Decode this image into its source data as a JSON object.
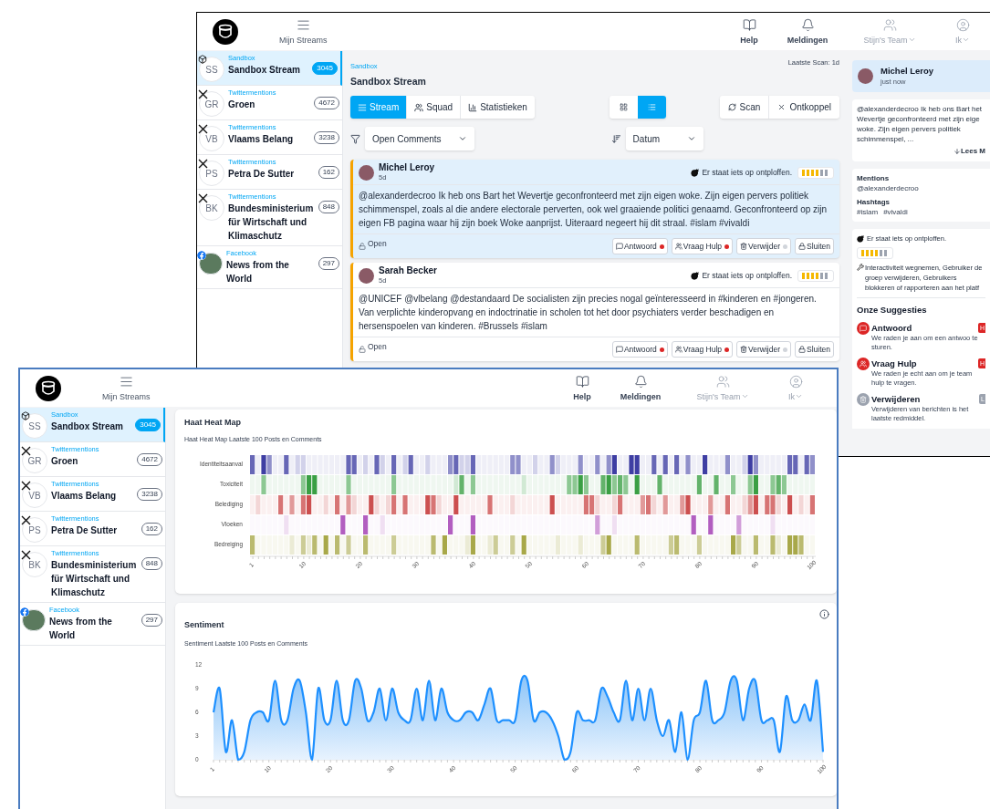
{
  "back_window": {
    "header": {
      "nav_label": "Mijn Streams",
      "items": [
        {
          "kind": "help",
          "label": "Help",
          "dropdown": false
        },
        {
          "kind": "bell",
          "label": "Meldingen",
          "dropdown": false
        },
        {
          "kind": "team",
          "label": "Stijn's Team",
          "dropdown": true
        },
        {
          "kind": "user",
          "label": "Ik",
          "dropdown": true
        }
      ]
    },
    "sidebar": [
      {
        "kind": "sandbox",
        "source": "Sandbox",
        "name": "Sandbox Stream",
        "initials": "SS",
        "count": "3045",
        "selected": true
      },
      {
        "kind": "x",
        "source": "Twittermentions",
        "name": "Groen",
        "initials": "GR",
        "count": "4672",
        "selected": false
      },
      {
        "kind": "x",
        "source": "Twittermentions",
        "name": "Vlaams Belang",
        "initials": "VB",
        "count": "3238",
        "selected": false
      },
      {
        "kind": "x",
        "source": "Twittermentions",
        "name": "Petra De Sutter",
        "initials": "PS",
        "count": "162",
        "selected": false
      },
      {
        "kind": "x",
        "source": "Twittermentions",
        "name": "Bundesministerium für Wirtschaft und Klimaschutz",
        "initials": "BK",
        "count": "848",
        "selected": false
      },
      {
        "kind": "facebook",
        "source": "Facebook",
        "name": "News from the World",
        "count": "297",
        "selected": false
      }
    ],
    "stream": {
      "category": "Sandbox",
      "title": "Sandbox Stream",
      "last_scan": "Laatste Scan: 1d",
      "tabs": [
        {
          "kind": "stream",
          "label": "Stream",
          "selected": true
        },
        {
          "kind": "squad",
          "label": "Squad",
          "selected": false
        },
        {
          "kind": "stats",
          "label": "Statistieken",
          "selected": false
        }
      ],
      "views": [
        {
          "kind": "grid",
          "selected": false
        },
        {
          "kind": "list",
          "selected": true
        }
      ],
      "actions": [
        {
          "kind": "scan",
          "label": "Scan"
        },
        {
          "kind": "disconnect",
          "label": "Ontkoppel"
        }
      ],
      "filter": {
        "value": "Open Comments"
      },
      "sort": {
        "value": "Datum"
      },
      "posts": [
        {
          "author": "Michel Leroy",
          "age": "5d",
          "selected": true,
          "alert": "Er staat iets op ontploffen.",
          "level": 0.67,
          "text": "@alexanderdecroo Ik heb ons Bart het Wevertje geconfronteerd met zijn eigen woke. Zijn eigen pervers politiek schimmenspel, zoals al die andere electorale perverten, ook wel graaiende politici genaamd. Geconfronteerd op zijn eigen FB pagina waar hij zijn boek Woke aanprijst. Uiteraard negeert hij dit straal. #islam #vivaldi",
          "status": "Open",
          "actions": [
            {
              "kind": "reply",
              "label": "Antwoord",
              "color": "#dc2626"
            },
            {
              "kind": "help",
              "label": "Vraag Hulp",
              "color": "#dc2626"
            },
            {
              "kind": "delete",
              "label": "Verwijder",
              "color": "#d1d5db"
            },
            {
              "kind": "close",
              "label": "Sluiten"
            }
          ]
        },
        {
          "author": "Sarah Becker",
          "age": "5d",
          "selected": false,
          "alert": "Er staat iets op ontploffen.",
          "level": 0.67,
          "text": "@UNICEF @vlbelang @destandaard De socialisten zijn precies nogal geïnteresseerd in #kinderen en #jongeren. Van verplichte kinderopvang en indoctrinatie in scholen tot het door psychiaters verder beschadigen en hersenspoelen van kinderen. #Brussels #islam",
          "status": "Open",
          "actions": [
            {
              "kind": "reply",
              "label": "Antwoord",
              "color": "#dc2626"
            },
            {
              "kind": "help",
              "label": "Vraag Hulp",
              "color": "#dc2626"
            },
            {
              "kind": "delete",
              "label": "Verwijder",
              "color": "#d1d5db"
            },
            {
              "kind": "close",
              "label": "Sluiten"
            }
          ]
        }
      ]
    },
    "detail": {
      "author": "Michel Leroy",
      "time": "just now",
      "excerpt": "@alexanderdecroo Ik heb ons Bart het Wevertje geconfronteerd met zijn eige woke. Zijn eigen pervers politiek schimmenspel, ...",
      "more": "Lees M",
      "mentions": {
        "label": "Mentions",
        "values": [
          "@alexanderdecroo"
        ]
      },
      "hashtags": {
        "label": "Hashtags",
        "values": [
          "#islam",
          "#vivaldi"
        ]
      },
      "alert": {
        "text": "Er staat iets op ontploffen.",
        "level": 0.67,
        "advice": "Interactiviteit wegnemen, Gebruiker de groep verwijderen, Gebruikers blokkeren of rapporteren aan het platf"
      },
      "suggestions": {
        "title": "Onze Suggesties",
        "items": [
          {
            "kind": "reply",
            "title": "Antwoord",
            "badge": "H",
            "color": "#dc2626",
            "text": "We raden je aan om een antwoo te sturen."
          },
          {
            "kind": "help",
            "title": "Vraag Hulp",
            "badge": "H",
            "color": "#dc2626",
            "text": "We raden je echt aan om je team hulp te vragen."
          },
          {
            "kind": "delete",
            "title": "Verwijderen",
            "badge": "L",
            "color": "#9ca3af",
            "text": "Verwijderen van berichten is het laatste redmiddel."
          }
        ]
      }
    }
  },
  "front_window": {
    "header": {
      "nav_label": "Mijn Streams",
      "items": [
        {
          "kind": "help",
          "label": "Help",
          "dropdown": false
        },
        {
          "kind": "bell",
          "label": "Meldingen",
          "dropdown": false
        },
        {
          "kind": "team",
          "label": "Stijn's Team",
          "dropdown": true
        },
        {
          "kind": "user",
          "label": "Ik",
          "dropdown": true
        }
      ]
    },
    "sidebar": [
      {
        "kind": "sandbox",
        "source": "Sandbox",
        "name": "Sandbox Stream",
        "initials": "SS",
        "count": "3045",
        "selected": true
      },
      {
        "kind": "x",
        "source": "Twittermentions",
        "name": "Groen",
        "initials": "GR",
        "count": "4672",
        "selected": false
      },
      {
        "kind": "x",
        "source": "Twittermentions",
        "name": "Vlaams Belang",
        "initials": "VB",
        "count": "3238",
        "selected": false
      },
      {
        "kind": "x",
        "source": "Twittermentions",
        "name": "Petra De Sutter",
        "initials": "PS",
        "count": "162",
        "selected": false
      },
      {
        "kind": "x",
        "source": "Twittermentions",
        "name": "Bundesministerium für Wirtschaft und Klimaschutz",
        "initials": "BK",
        "count": "848",
        "selected": false
      },
      {
        "kind": "facebook",
        "source": "Facebook",
        "name": "News from the World",
        "count": "297",
        "selected": false
      }
    ],
    "heatmap": {
      "title": "Haat Heat Map",
      "subtitle": "Haat Heat Map Laatste 100 Posts en Comments",
      "rows": [
        {
          "label": "Identiteitsaanval",
          "color": "#34349e"
        },
        {
          "label": "Toxiciteit",
          "color": "#2f9a3a"
        },
        {
          "label": "Belediging",
          "color": "#c94646"
        },
        {
          "label": "Vloeken",
          "color": "#b25ec0"
        },
        {
          "label": "Bedreiging",
          "color": "#a3a33f"
        }
      ],
      "xticks": [
        "1",
        "10",
        "20",
        "30",
        "40",
        "50",
        "60",
        "70",
        "80",
        "90",
        "100"
      ]
    },
    "sentiment": {
      "subtitle": "Sentiment Laatste 100 Posts en Comments",
      "chart_data": {
        "type": "area",
        "title": "Sentiment",
        "x": [
          1,
          2,
          3,
          4,
          5,
          6,
          7,
          8,
          9,
          10,
          11,
          12,
          13,
          14,
          15,
          16,
          17,
          18,
          19,
          20,
          21,
          22,
          23,
          24,
          25,
          26,
          27,
          28,
          29,
          30,
          31,
          32,
          33,
          34,
          35,
          36,
          37,
          38,
          39,
          40,
          41,
          42,
          43,
          44,
          45,
          46,
          47,
          48,
          49,
          50,
          51,
          52,
          53,
          54,
          55,
          56,
          57,
          58,
          59,
          60,
          61,
          62,
          63,
          64,
          65,
          66,
          67,
          68,
          69,
          70,
          71,
          72,
          73,
          74,
          75,
          76,
          77,
          78,
          79,
          80,
          81,
          82,
          83,
          84,
          85,
          86,
          87,
          88,
          89,
          90,
          91,
          92,
          93,
          94,
          95,
          96,
          97,
          98,
          99,
          100
        ],
        "xlim": [
          1,
          100
        ],
        "ylim": [
          0,
          12
        ],
        "xticks": [
          {
            "value": 1,
            "label": "1"
          },
          {
            "value": 10,
            "label": "10"
          },
          {
            "value": 20,
            "label": "20"
          },
          {
            "value": 30,
            "label": "30"
          },
          {
            "value": 40,
            "label": "40"
          },
          {
            "value": 50,
            "label": "50"
          },
          {
            "value": 60,
            "label": "60"
          },
          {
            "value": 70,
            "label": "70"
          },
          {
            "value": 80,
            "label": "80"
          },
          {
            "value": 90,
            "label": "90"
          },
          {
            "value": 100,
            "label": "100"
          }
        ],
        "yticks": [
          {
            "value": 0,
            "label": "0"
          },
          {
            "value": 3,
            "label": "3"
          },
          {
            "value": 6,
            "label": "6"
          },
          {
            "value": 9,
            "label": "9"
          },
          {
            "value": 12,
            "label": "12"
          }
        ],
        "series": [
          {
            "color": "#1e90ff",
            "values": [
              6,
              9,
              1,
              5,
              0,
              1,
              5,
              6,
              6,
              5,
              10,
              5,
              5,
              9,
              10,
              6,
              0,
              9,
              5,
              5,
              10,
              5,
              5,
              10,
              9,
              5,
              6,
              9,
              5,
              9,
              6,
              5,
              5,
              9,
              5,
              10,
              5,
              9,
              6,
              5,
              5,
              6,
              6,
              5,
              7,
              9,
              5,
              5,
              5,
              5,
              10,
              10,
              5,
              6,
              6,
              5,
              3,
              0,
              1,
              6,
              5,
              5,
              5,
              9,
              8,
              6,
              5,
              10,
              5,
              9,
              5,
              9,
              5,
              3,
              5,
              1,
              6,
              0,
              5,
              6,
              10,
              5,
              5,
              6,
              10,
              10,
              5,
              9,
              10,
              5,
              5,
              5,
              1,
              8,
              5,
              5,
              7,
              5,
              10,
              1
            ]
          }
        ]
      }
    }
  }
}
